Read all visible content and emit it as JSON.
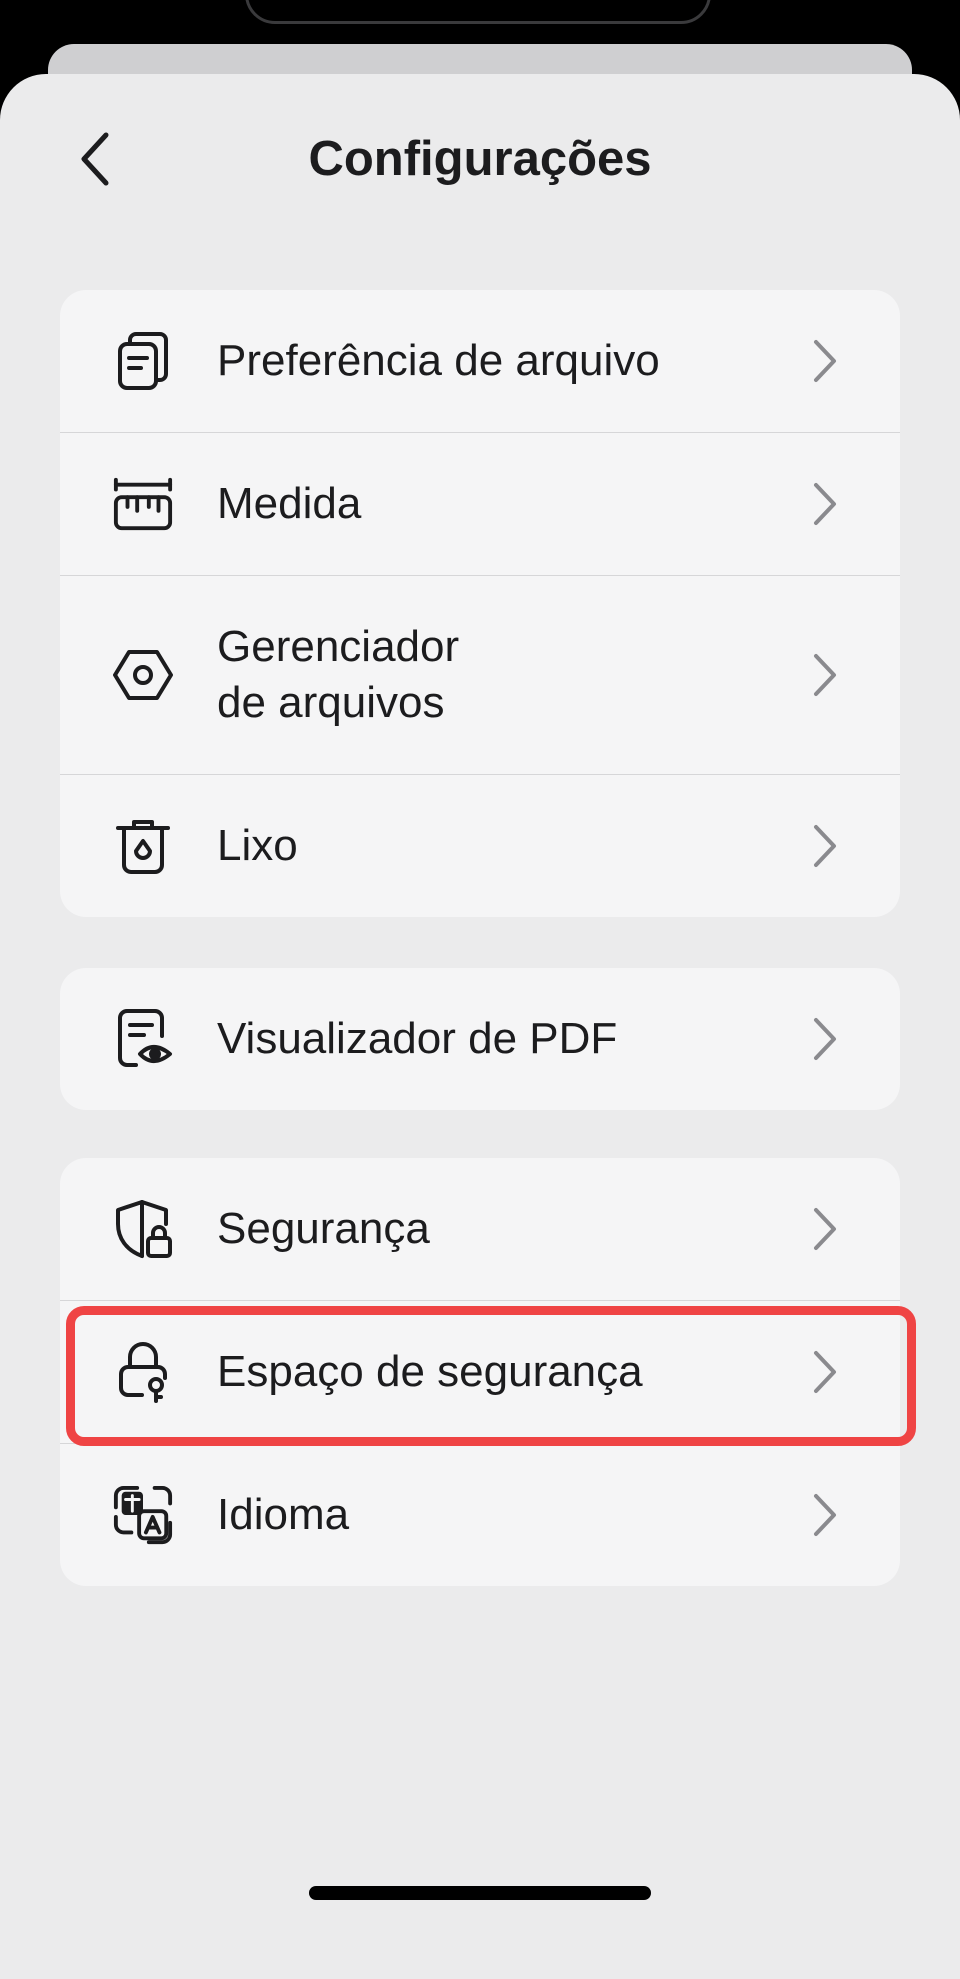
{
  "app": {
    "title": "Configurações"
  },
  "header": {
    "back_icon": "chevron-left-icon"
  },
  "groups": [
    {
      "items": [
        {
          "label": "Preferência de arquivo",
          "icon": "file-stack-icon"
        },
        {
          "label": "Medida",
          "icon": "ruler-icon"
        },
        {
          "label": "Gerenciador\nde arquivos",
          "icon": "hexagon-nut-icon"
        },
        {
          "label": "Lixo",
          "icon": "trash-icon"
        }
      ]
    },
    {
      "items": [
        {
          "label": "Visualizador de PDF",
          "icon": "document-eye-icon"
        }
      ]
    },
    {
      "items": [
        {
          "label": "Segurança",
          "icon": "shield-lock-icon"
        },
        {
          "label": "Espaço de segurança",
          "icon": "lock-key-icon",
          "highlighted": true
        },
        {
          "label": "Idioma",
          "icon": "translate-icon"
        }
      ]
    }
  ],
  "colors": {
    "background": "#ebebec",
    "card": "#f5f5f6",
    "text": "#1c1c1e",
    "chevron": "#8a8a8e",
    "highlight": "#ef4444"
  }
}
